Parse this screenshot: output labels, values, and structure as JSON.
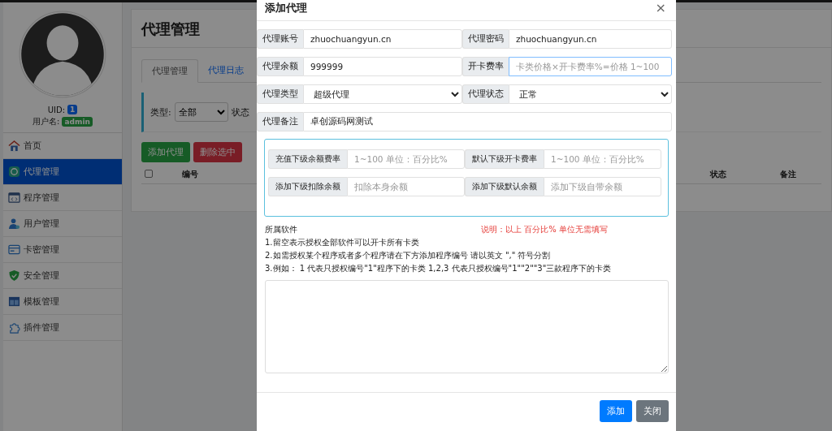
{
  "sidebar": {
    "uid_label": "UID:",
    "uid": "1",
    "username_label": "用户名:",
    "username": "admin",
    "items": [
      {
        "label": "首页",
        "selected": false
      },
      {
        "label": "代理管理",
        "selected": true
      },
      {
        "label": "程序管理",
        "selected": false
      },
      {
        "label": "用户管理",
        "selected": false
      },
      {
        "label": "卡密管理",
        "selected": false
      },
      {
        "label": "安全管理",
        "selected": false
      },
      {
        "label": "模板管理",
        "selected": false
      },
      {
        "label": "插件管理",
        "selected": false
      }
    ]
  },
  "main": {
    "title": "代理管理",
    "tabs": [
      {
        "label": "代理管理",
        "selected": true
      },
      {
        "label": "代理日志",
        "selected": false
      }
    ],
    "filter": {
      "type_label": "类型:",
      "type_value": "全部",
      "status_label": "状态"
    },
    "buttons": [
      {
        "label": "添加代理",
        "kind": "success"
      },
      {
        "label": "删除选中",
        "kind": "danger"
      }
    ],
    "table": {
      "checked": false,
      "columns": [
        "编号",
        "状态",
        "备注"
      ]
    }
  },
  "modal": {
    "title": "添加代理",
    "close": "×",
    "fields": [
      {
        "label": "代理账号",
        "kind": "input",
        "value": "zhuochuangyun.cn",
        "focused": false
      },
      {
        "label": "代理密码",
        "kind": "input",
        "value": "zhuochuangyun.cn",
        "focused": false
      },
      {
        "label": "代理余额",
        "kind": "input",
        "value": "999999",
        "focused": false
      },
      {
        "label": "开卡费率",
        "kind": "input",
        "placeholder": "卡类价格×开卡费率%=价格 1~100",
        "focused": true
      },
      {
        "label": "代理类型",
        "kind": "select",
        "value": "超级代理",
        "focused": false
      },
      {
        "label": "代理状态",
        "kind": "select",
        "value": "正常",
        "focused": false
      },
      {
        "label": "代理备注",
        "kind": "wide",
        "value": "卓创源码网测试",
        "focused": false
      }
    ],
    "sub_fields": [
      {
        "label": "充值下级余额费率",
        "placeholder": "1~100 单位：百分比%"
      },
      {
        "label": "默认下级开卡费率",
        "placeholder": "1~100 单位：百分比%"
      },
      {
        "label": "添加下级扣除余额",
        "placeholder": "扣除本身余额"
      },
      {
        "label": "添加下级默认余额",
        "placeholder": "添加下级自带余额"
      }
    ],
    "software_label": "所属软件",
    "note": "说明：以上 百分比% 单位无需填写",
    "instructions": [
      "1.留空表示授权全部软件可以开卡所有卡类",
      "2.如需授权某个程序或者多个程序请在下方添加程序编号 请以英文 \",\" 符号分割",
      "3.例如： 1 代表只授权编号\"1\"程序下的卡类 1,2,3 代表只授权编号\"1\"\"2\"\"3\"三款程序下的卡类"
    ],
    "buttons": [
      {
        "label": "添加",
        "kind": "primary"
      },
      {
        "label": "关闭",
        "kind": "secondary"
      }
    ]
  }
}
